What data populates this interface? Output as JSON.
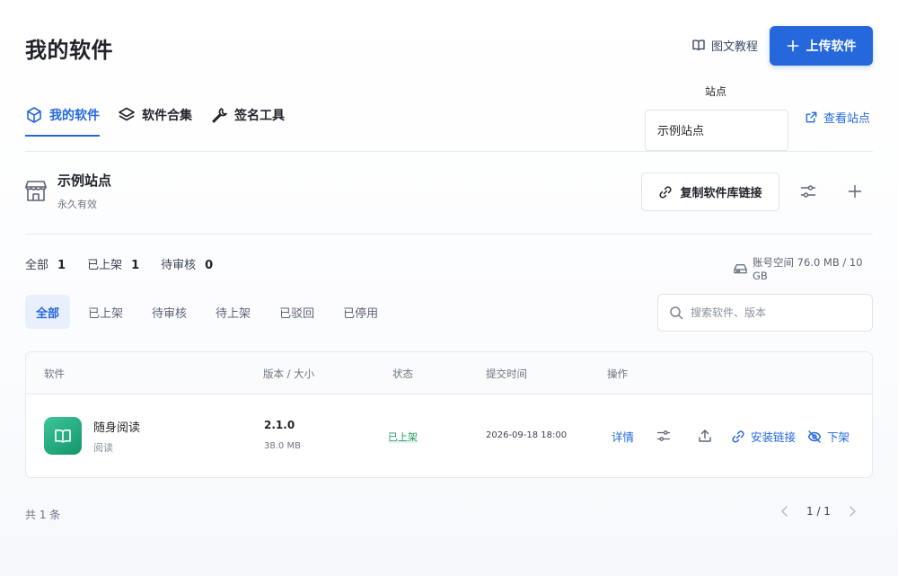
{
  "header": {
    "title": "我的软件",
    "tutorial_label": "图文教程",
    "upload_label": "上传软件"
  },
  "tabs": [
    {
      "label": "我的软件",
      "icon": "cube-icon",
      "active": true
    },
    {
      "label": "软件合集",
      "icon": "layers-icon",
      "active": false
    },
    {
      "label": "签名工具",
      "icon": "wrench-icon",
      "active": false
    }
  ],
  "site": {
    "label": "站点",
    "selected": "示例站点",
    "view_label": "查看站点"
  },
  "store": {
    "name": "示例站点",
    "validity": "永久有效",
    "copy_label": "复制软件库链接"
  },
  "stats": {
    "all_label": "全部",
    "all_count": "1",
    "listed_label": "已上架",
    "listed_count": "1",
    "pending_label": "待审核",
    "pending_count": "0",
    "storage": "账号空间 76.0 MB / 10 GB"
  },
  "filters": [
    "全部",
    "已上架",
    "待审核",
    "待上架",
    "已驳回",
    "已停用"
  ],
  "search": {
    "placeholder": "搜索软件、版本"
  },
  "table": {
    "columns": [
      "软件",
      "版本 / 大小",
      "状态",
      "提交时间",
      "操作"
    ],
    "rows": [
      {
        "name": "随身阅读",
        "category": "阅读",
        "version": "2.1.0",
        "size": "38.0 MB",
        "status": "已上架",
        "time": "2026-09-18 18:00",
        "detail_label": "详情",
        "install_label": "安装链接",
        "unlist_label": "下架"
      }
    ]
  },
  "footer": {
    "total": "共 1 条",
    "page": "1 / 1"
  },
  "colors": {
    "accent": "#2468dc",
    "success": "#1f9a5c",
    "app_icon": "#1fa97a"
  }
}
